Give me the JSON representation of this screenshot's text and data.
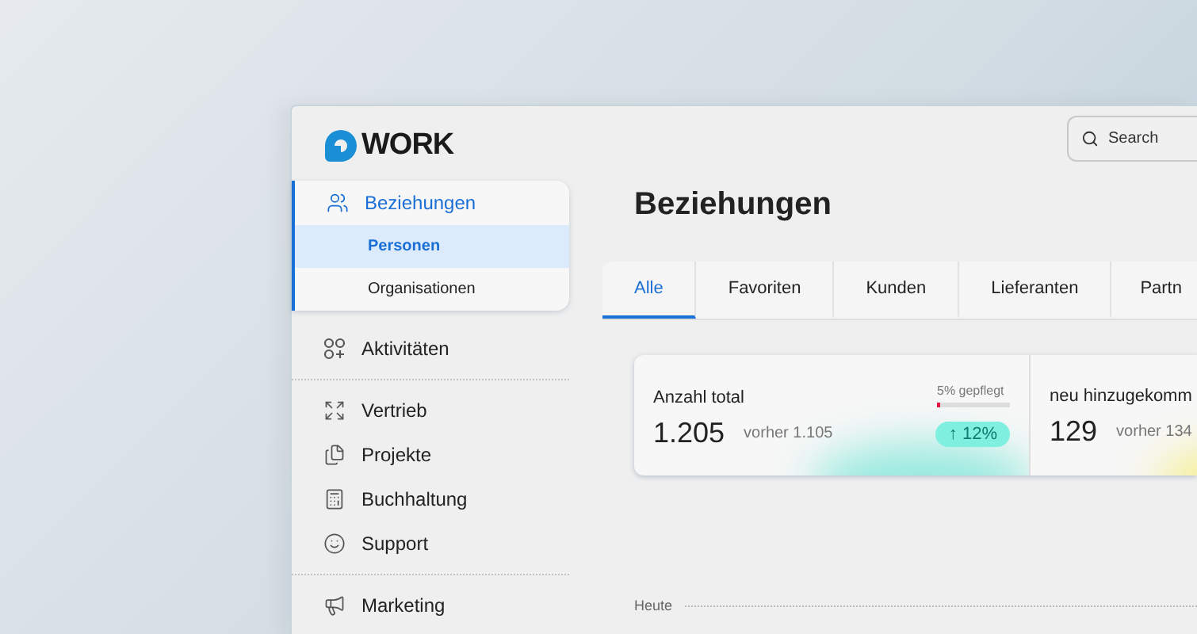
{
  "logo": {
    "text": "WORK"
  },
  "search": {
    "placeholder": "Search"
  },
  "sidebar": {
    "items": [
      {
        "label": "Beziehungen",
        "selected": true,
        "expanded": true,
        "children": [
          {
            "label": "Personen",
            "selected": true
          },
          {
            "label": "Organisationen",
            "selected": false
          }
        ]
      },
      {
        "label": "Aktivitäten",
        "selected": false
      },
      {
        "label": "Vertrieb",
        "selected": false
      },
      {
        "label": "Projekte",
        "selected": false
      },
      {
        "label": "Buchhaltung",
        "selected": false
      },
      {
        "label": "Support",
        "selected": false
      },
      {
        "label": "Marketing",
        "selected": false
      }
    ]
  },
  "page": {
    "title": "Beziehungen"
  },
  "tabs": [
    {
      "label": "Alle",
      "selected": true
    },
    {
      "label": "Favoriten",
      "selected": false
    },
    {
      "label": "Kunden",
      "selected": false
    },
    {
      "label": "Lieferanten",
      "selected": false
    },
    {
      "label": "Partn",
      "selected": false
    }
  ],
  "stats": [
    {
      "title": "Anzahl total",
      "value": "1.205",
      "previous": "vorher 1.105",
      "meter": {
        "label": "5% gepflegt",
        "level": 0.05
      },
      "change": "↑ 12%"
    },
    {
      "title": "neu hinzugekomm",
      "value": "129",
      "previous": "vorher 134"
    }
  ],
  "timeline": {
    "label": "Heute"
  }
}
